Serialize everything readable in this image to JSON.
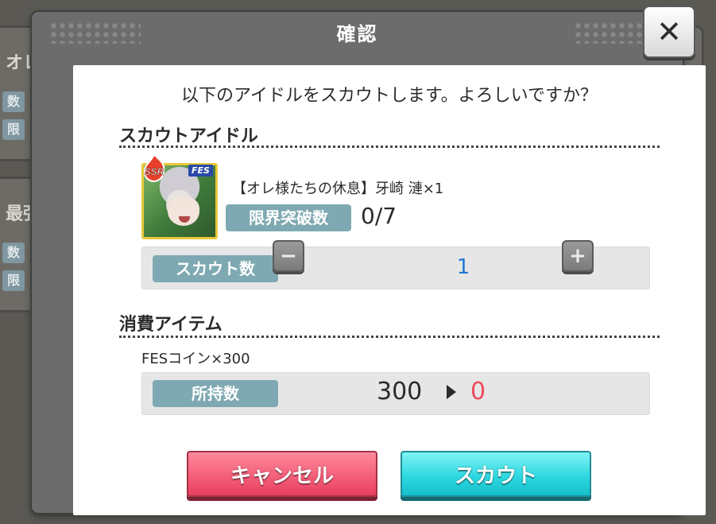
{
  "background": {
    "panel1_text": "オレ様",
    "panel1_chips": [
      "数",
      "限"
    ],
    "panel2_text": "最強",
    "panel2_chips": [
      "数",
      "限"
    ]
  },
  "dialog": {
    "title": "確認",
    "close_label": "✕",
    "prompt": "以下のアイドルをスカウトします。よろしいですか？",
    "scout_idol_section": "スカウトアイドル",
    "idol": {
      "rarity": "SSR",
      "event_badge": "FES",
      "name": "【オレ様たちの休息】牙崎 漣×1",
      "limit_break_label": "限界突破数",
      "limit_break_value": "0/7"
    },
    "scout_count": {
      "label": "スカウト数",
      "minus": "−",
      "plus": "+",
      "value": "1"
    },
    "consume_section": "消費アイテム",
    "item": {
      "name": "FESコイン×300",
      "owned_label": "所持数",
      "owned_before": "300",
      "owned_after": "0"
    },
    "buttons": {
      "cancel": "キャンセル",
      "scout": "スカウト"
    }
  },
  "colors": {
    "limit_chip": "#7fa9b2",
    "scout_count_value": "#1f78d1",
    "owned_after": "#ee4b5f",
    "cancel_button": "#f45f7a",
    "scout_button": "#2fd8e0"
  }
}
